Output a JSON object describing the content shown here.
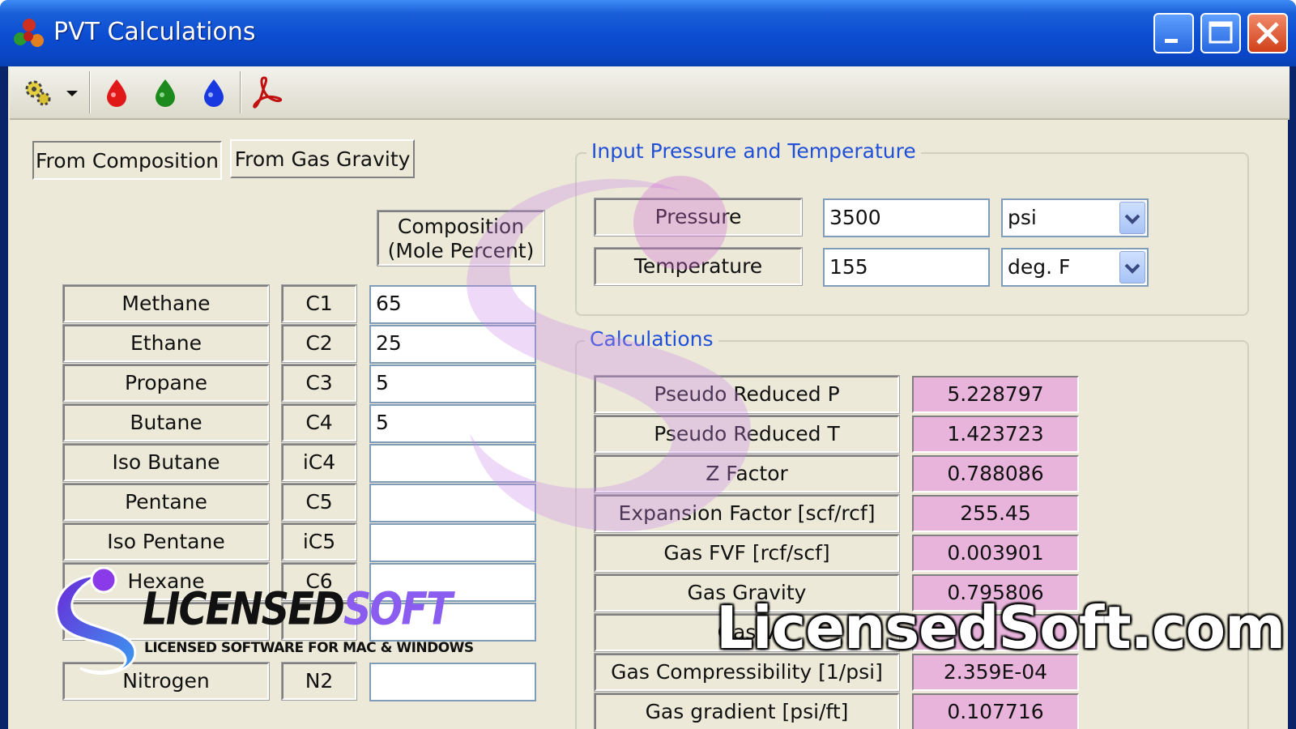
{
  "window": {
    "title": "PVT Calculations"
  },
  "toolbar": {
    "icons": [
      "settings-gear-icon",
      "dropdown-arrow-icon",
      "red-drop-icon",
      "green-drop-icon",
      "blue-drop-icon",
      "pdf-icon"
    ]
  },
  "tabs": [
    {
      "label": "From Composition",
      "active": true
    },
    {
      "label": "From Gas Gravity",
      "active": false
    }
  ],
  "composition": {
    "header_line1": "Composition",
    "header_line2": "(Mole Percent)",
    "rows": [
      {
        "name": "Methane",
        "formula": "C1",
        "value": "65"
      },
      {
        "name": "Ethane",
        "formula": "C2",
        "value": "25"
      },
      {
        "name": "Propane",
        "formula": "C3",
        "value": "5"
      },
      {
        "name": "Butane",
        "formula": "C4",
        "value": "5"
      },
      {
        "name": "Iso Butane",
        "formula": "iC4",
        "value": ""
      },
      {
        "name": "Pentane",
        "formula": "C5",
        "value": ""
      },
      {
        "name": "Iso Pentane",
        "formula": "iC5",
        "value": ""
      },
      {
        "name": "Hexane",
        "formula": "C6",
        "value": ""
      },
      {
        "name": "",
        "formula": "",
        "value": ""
      },
      {
        "name": "Nitrogen",
        "formula": "N2",
        "value": ""
      }
    ]
  },
  "input_group": {
    "title": "Input Pressure and Temperature",
    "pressure": {
      "label": "Pressure",
      "value": "3500",
      "unit": "psi"
    },
    "temperature": {
      "label": "Temperature",
      "value": "155",
      "unit": "deg. F"
    }
  },
  "calculations": {
    "title": "Calculations",
    "rows": [
      {
        "label": "Pseudo Reduced P",
        "value": "5.228797"
      },
      {
        "label": "Pseudo Reduced T",
        "value": "1.423723"
      },
      {
        "label": "Z Factor",
        "value": "0.788086"
      },
      {
        "label": "Expansion Factor [scf/rcf]",
        "value": "255.45"
      },
      {
        "label": "Gas FVF [rcf/scf]",
        "value": "0.003901"
      },
      {
        "label": "Gas Gravity",
        "value": "0.795806"
      },
      {
        "label": "Gas V",
        "value": ""
      },
      {
        "label": "Gas Compressibility [1/psi]",
        "value": "2.359E-04"
      },
      {
        "label": "Gas gradient [psi/ft]",
        "value": "0.107716"
      }
    ]
  },
  "watermark": {
    "brand_plain": "LICENSED",
    "brand_accent": "SOFT",
    "tagline": "LICENSED SOFTWARE FOR MAC & WINDOWS",
    "site": "LicensedSoft.com"
  }
}
